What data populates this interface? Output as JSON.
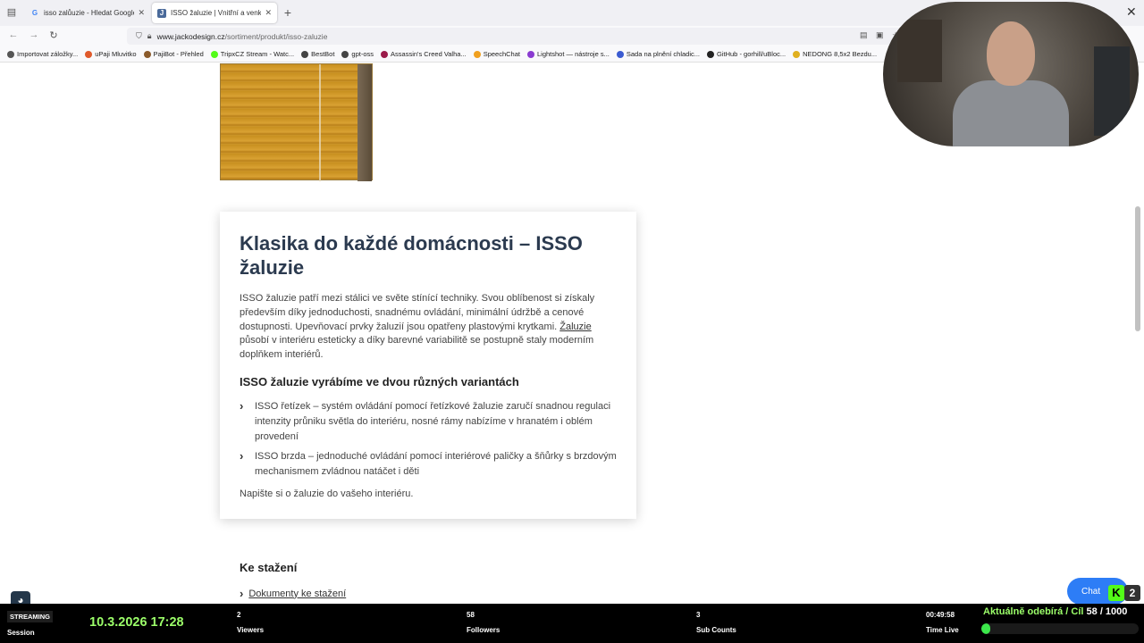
{
  "browser": {
    "tabs": [
      {
        "title": "isso zalůuzie - Hledat Googlem",
        "favicon": "G",
        "active": false
      },
      {
        "title": "ISSO žaluzie | Vnitřní a venkovní",
        "favicon": "J",
        "active": true
      }
    ],
    "url_domain": "www.jackodesign.cz",
    "url_path": "/sortiment/produkt/isso-zaluzie",
    "bookmarks": [
      {
        "label": "Importovat záložky...",
        "color": "#555555"
      },
      {
        "label": "uPaji Mluvitko",
        "color": "#e05a2b"
      },
      {
        "label": "PajiBot - Přehled",
        "color": "#8a5a2b"
      },
      {
        "label": "TripxCZ Stream - Watc...",
        "color": "#53fc18"
      },
      {
        "label": "BestBot",
        "color": "#444444"
      },
      {
        "label": "gpt-oss",
        "color": "#444444"
      },
      {
        "label": "Assassin's Creed Valha...",
        "color": "#9b1b4a"
      },
      {
        "label": "SpeechChat",
        "color": "#f0a020"
      },
      {
        "label": "Lightshot — nástroje s...",
        "color": "#8a3bd1"
      },
      {
        "label": "Sada na plnění chladic...",
        "color": "#3b5bd1"
      },
      {
        "label": "GitHub - gorhill/uBloc...",
        "color": "#222222"
      },
      {
        "label": "NEDONG 8,5x2 Bezdu...",
        "color": "#e0b020"
      }
    ]
  },
  "article": {
    "heading": "Klasika do každé domácnosti – ISSO žaluzie",
    "intro_before_link": "ISSO žaluzie patří mezi stálici ve světe stínící techniky. Svou oblíbenost si získaly především díky jednoduchosti, snadnému ovládání, minimální údržbě a cenové dostupnosti. Upevňovací prvky žaluzií jsou opatřeny plastovými krytkami. ",
    "intro_link": "Žaluzie",
    "intro_after_link": " působí v interiéru esteticky a díky barevné variabilitě se postupně staly moderním doplňkem interiérů.",
    "subheading": "ISSO žaluzie vyrábíme ve dvou různých variantách",
    "variants": [
      "ISSO řetízek – systém ovládání pomocí řetízkové žaluzie zaručí snadnou regulaci intenzity průniku světla do interiéru, nosné rámy nabízíme v hranatém i oblém provedení",
      "ISSO brzda – jednoduché ovládání pomocí interiérové paličky a šňůrky s brzdovým mechanismem zvládnou natáčet i děti"
    ],
    "outro": "Napište si o žaluzie do vašeho interiéru."
  },
  "downloads": {
    "title": "Ke stažení",
    "link": "Dokumenty ke stažení"
  },
  "widgets": {
    "chat_label": "Chat",
    "kick_count": "2"
  },
  "stream": {
    "badge": "STREAMING",
    "session_label": "Session",
    "datetime": "10.3.2026 17:28",
    "viewers_value": "2",
    "viewers_label": "Viewers",
    "followers_value": "58",
    "followers_label": "Followers",
    "subs_value": "3",
    "subs_label": "Sub Counts",
    "live_time": "00:49:58",
    "live_label": "Time Live",
    "goal_label": "Aktuálně odebírá / Cíl",
    "goal_count": "58 / 1000",
    "goal_progress": 0.058,
    "accent_color": "#9cff6a"
  }
}
